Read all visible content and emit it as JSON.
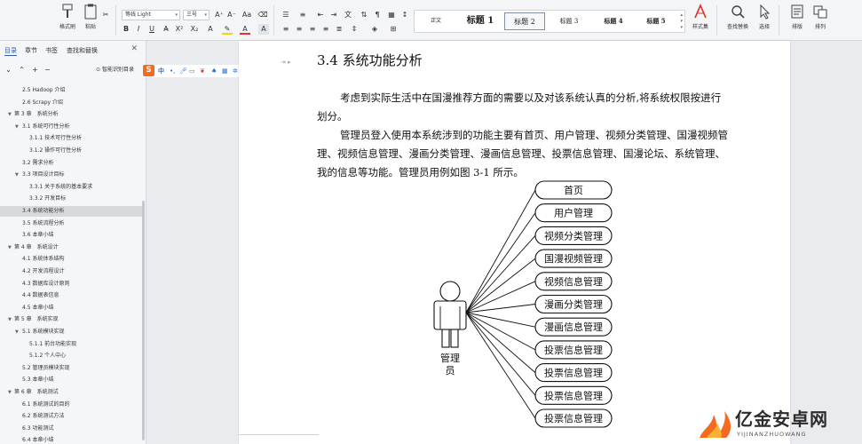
{
  "ribbon": {
    "format_painter": "格式刷",
    "paste": "粘贴",
    "font_name": "等线 Light",
    "font_size": "三号",
    "styles": [
      "正文",
      "标题 1",
      "标题 2",
      "标题 3",
      "标题 4",
      "标题 5"
    ],
    "selected_style": "标题 2",
    "style_set": "样式集",
    "find_replace": "查找替换",
    "select": "选择",
    "layout": "排版",
    "arrange": "排列"
  },
  "nav_pane": {
    "tabs": [
      "目录",
      "章节",
      "书签",
      "查找和替换"
    ],
    "active_tab": "目录",
    "smart_toc": "智能识别目录",
    "toc": [
      {
        "label": "2.5 Hadoop 介绍",
        "level": 2,
        "arrow": ""
      },
      {
        "label": "2.6 Scrapy 介绍",
        "level": 2,
        "arrow": ""
      },
      {
        "label": "第 3 章　系统分析",
        "level": 1,
        "arrow": "▼"
      },
      {
        "label": "3.1 系统可行性分析",
        "level": 2,
        "arrow": "▼"
      },
      {
        "label": "3.1.1 技术可行性分析",
        "level": 3,
        "arrow": ""
      },
      {
        "label": "3.1.2 操作可行性分析",
        "level": 3,
        "arrow": ""
      },
      {
        "label": "3.2 需求分析",
        "level": 2,
        "arrow": ""
      },
      {
        "label": "3.3 项目设计目标",
        "level": 2,
        "arrow": "▼"
      },
      {
        "label": "3.3.1 关于系统的基本要求",
        "level": 3,
        "arrow": ""
      },
      {
        "label": "3.3.2 开发目标",
        "level": 3,
        "arrow": ""
      },
      {
        "label": "3.4 系统功能分析",
        "level": 2,
        "arrow": "",
        "active": true
      },
      {
        "label": "3.5 系统流程分析",
        "level": 2,
        "arrow": ""
      },
      {
        "label": "3.6 本章小结",
        "level": 2,
        "arrow": ""
      },
      {
        "label": "第 4 章　系统设计",
        "level": 1,
        "arrow": "▼"
      },
      {
        "label": "4.1 系统体系结构",
        "level": 2,
        "arrow": ""
      },
      {
        "label": "4.2 开发流程设计",
        "level": 2,
        "arrow": ""
      },
      {
        "label": "4.3 数据库设计原则",
        "level": 2,
        "arrow": ""
      },
      {
        "label": "4.4 数据表信息",
        "level": 2,
        "arrow": ""
      },
      {
        "label": "4.5 本章小结",
        "level": 2,
        "arrow": ""
      },
      {
        "label": "第 5 章　系统实现",
        "level": 1,
        "arrow": "▼"
      },
      {
        "label": "5.1 系统模块实现",
        "level": 2,
        "arrow": "▼"
      },
      {
        "label": "5.1.1 前台功能实现",
        "level": 3,
        "arrow": ""
      },
      {
        "label": "5.1.2 个人中心",
        "level": 3,
        "arrow": ""
      },
      {
        "label": "5.2 管理员模块实现",
        "level": 2,
        "arrow": ""
      },
      {
        "label": "5.3 本章小结",
        "level": 2,
        "arrow": ""
      },
      {
        "label": "第 6 章　系统测试",
        "level": 1,
        "arrow": "▼"
      },
      {
        "label": "6.1 系统测试的目的",
        "level": 2,
        "arrow": ""
      },
      {
        "label": "6.2 系统测试方法",
        "level": 2,
        "arrow": ""
      },
      {
        "label": "6.3 功能测试",
        "level": 2,
        "arrow": ""
      },
      {
        "label": "6.4 本章小结",
        "level": 2,
        "arrow": ""
      }
    ]
  },
  "ime": {
    "mode": "中"
  },
  "document": {
    "heading": "3.4 系统功能分析",
    "para1": "考虑到实际生活中在国漫推荐方面的需要以及对该系统认真的分析,将系统权限按进行划分。",
    "para2": "管理员登入使用本系统涉到的功能主要有首页、用户管理、视频分类管理、国漫视频管理、视频信息管理、漫画分类管理、漫画信息管理、投票信息管理、国漫论坛、系统管理、我的信息等功能。管理员用例如图 3-1 所示。",
    "actor": [
      "管理",
      "员"
    ],
    "use_cases": [
      "首页",
      "用户管理",
      "视频分类管理",
      "国漫视频管理",
      "视频信息管理",
      "漫画分类管理",
      "漫画信息管理",
      "投票信息管理",
      "投票信息管理",
      "投票信息管理",
      "投票信息管理"
    ]
  },
  "watermark": {
    "title": "亿金安卓网",
    "subtitle": "YIJINANZHUOWANG"
  },
  "colors": {
    "accent": "#2b5fb6",
    "logo_orange": "#f26b21"
  }
}
